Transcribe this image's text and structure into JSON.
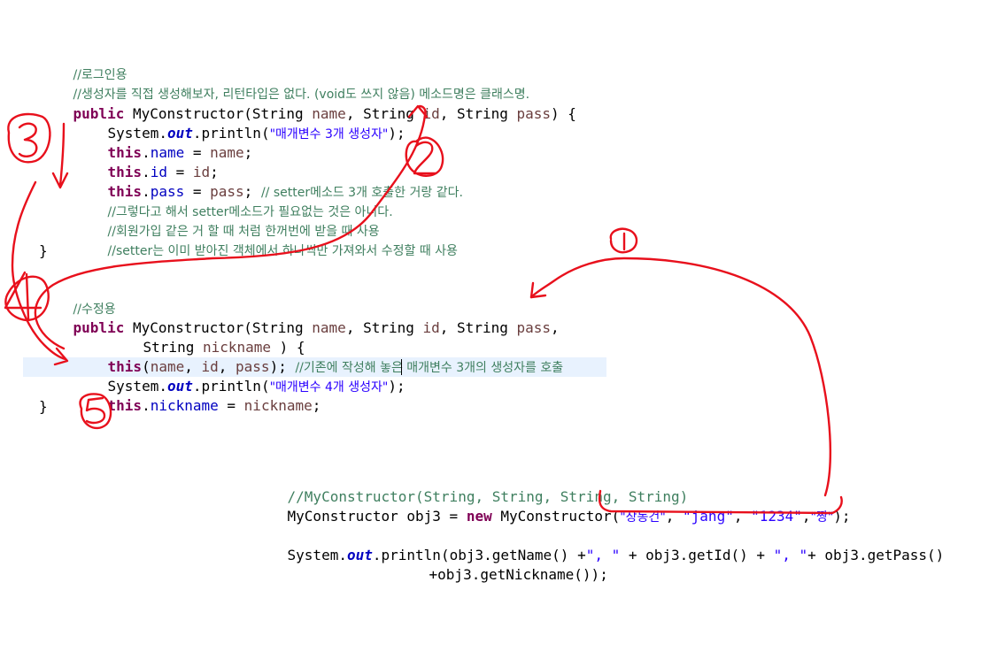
{
  "code_top": {
    "comment_login": "//로그인용",
    "comment_ctor_desc": "//생성자를 직접 생성해보자, 리턴타입은 없다. (void도 쓰지 않음) 메소드명은 클래스명.",
    "kw_public": "public",
    "ctor_name": "MyConstructor",
    "type_string": "String",
    "p_name": "name",
    "p_id": "id",
    "p_pass": "pass",
    "p_nickname": "nickname",
    "kw_this": "this",
    "system": "System.",
    "out": "out",
    "println": ".println(",
    "str_3params": "\"매개변수 3개 생성자\"",
    "str_4params": "\"매개변수 4개 생성자\"",
    "comment_setter_same": "// setter메소드 3개 호출한 거랑 같다.",
    "comment_not_useless": "//그렇다고 해서 setter메소드가 필요없는 것은 아니다.",
    "comment_signup": "//회원가입 같은 거 할 때 처럼 한꺼번에 받을 때 사용",
    "comment_setter_usage": "//setter는 이미 받아진 객체에서 하나씩만 가져와서 수정할 때 사용",
    "comment_modify": "//수정용",
    "comment_call_existing": "//기존에 작성해 놓은 매개변수 3개의 생성자를 호출"
  },
  "code_bottom": {
    "comment_signature": "//MyConstructor(String, String, String, String)",
    "decl_prefix": "MyConstructor obj3 = ",
    "kw_new": "new",
    "ctor_call": " MyConstructor(",
    "arg1": "\"장동건\"",
    "arg2": "\"jang\"",
    "arg3": "\"1234\"",
    "arg4": "\"짱\"",
    "print_prefix": ".println(obj3.getName() +",
    "sep1": "\", \"",
    "mid1": " + obj3.getId() + ",
    "sep2": "\", \"",
    "mid2": "+ obj3.getPass()",
    "line2": "+obj3.getNickname());"
  },
  "annotations": {
    "n1": "1",
    "n2": "2",
    "n3": "3",
    "n4": "4",
    "n5": "5",
    "ink_color": "#e8101c"
  },
  "colors": {
    "keyword": "#7f0055",
    "comment": "#3f7f5f",
    "string": "#2a00ff",
    "field": "#0000c0",
    "current_line": "#e8f2fe"
  }
}
